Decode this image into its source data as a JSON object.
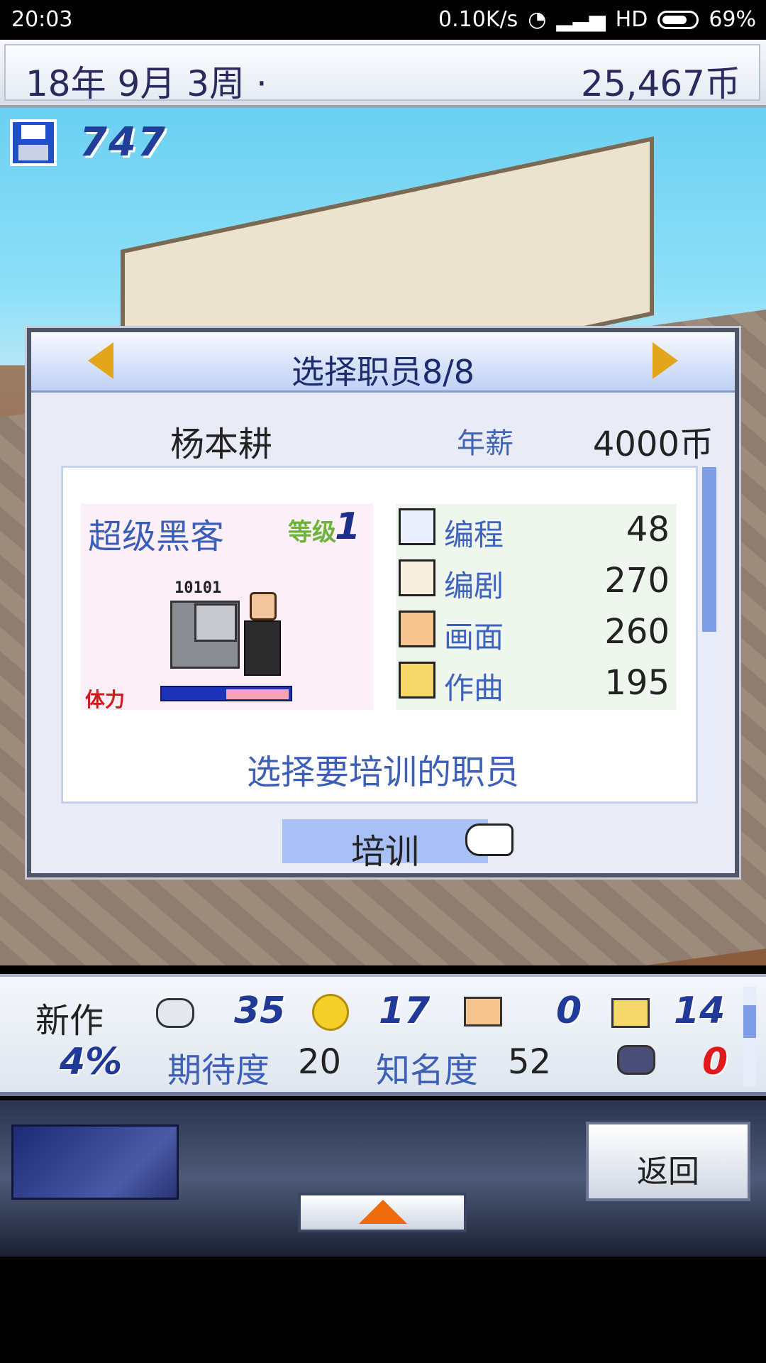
{
  "status_bar": {
    "time": "20:03",
    "net_speed": "0.10K/s",
    "network": "HD",
    "battery": "69%"
  },
  "top_bar": {
    "date": "18年 9月 3周 ·",
    "money": "25,467币"
  },
  "scene": {
    "points": "747"
  },
  "dialog": {
    "title": "选择职员8/8",
    "staff_name": "杨本耕",
    "salary_label": "年薪",
    "salary_value": "4000币",
    "role": "超级黑客",
    "level_label": "等级",
    "level_value": "1",
    "screen_text": "10101",
    "stamina_label": "体力",
    "stamina_fraction": 0.5,
    "skills": [
      {
        "icon": "computer-icon",
        "label": "编程",
        "value": "48"
      },
      {
        "icon": "book-icon",
        "label": "编剧",
        "value": "270"
      },
      {
        "icon": "palette-icon",
        "label": "画面",
        "value": "260"
      },
      {
        "icon": "trumpet-icon",
        "label": "作曲",
        "value": "195"
      }
    ],
    "hint": "选择要培训的职员",
    "train_button": "培训"
  },
  "bottom_panel": {
    "new_game_label": "新作",
    "progress": "4%",
    "fun": "35",
    "creativity": "17",
    "graphics": "0",
    "sound": "14",
    "expectation_label": "期待度",
    "expectation_value": "20",
    "fame_label": "知名度",
    "fame_value": "52",
    "bugs": "0"
  },
  "nav": {
    "back_button": "返回"
  },
  "colors": {
    "accent_blue": "#3d5fb8",
    "dialog_header": "#bfd1f5",
    "arrow_gold": "#e2a51b",
    "stamina_red": "#d21b1b"
  }
}
